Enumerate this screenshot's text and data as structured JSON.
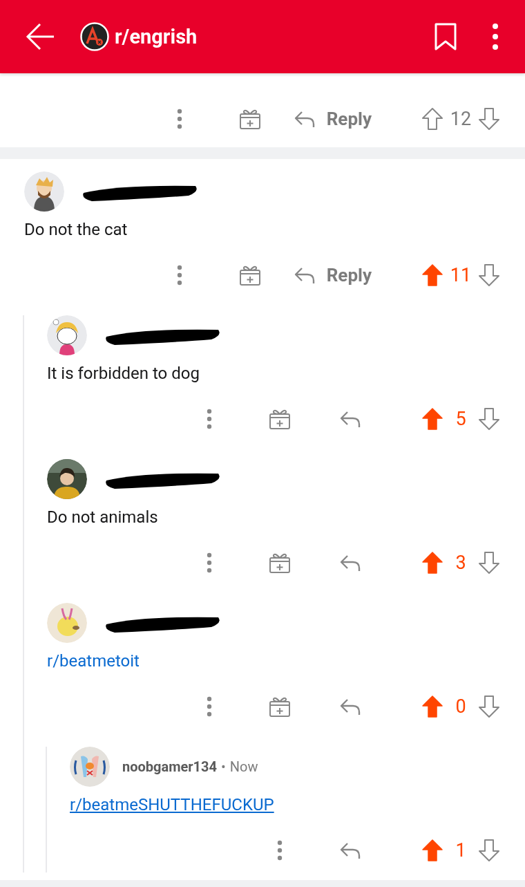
{
  "header": {
    "title": "r/engrish"
  },
  "partial_comment": {
    "actions": {
      "gift": true,
      "reply_label": "Reply",
      "upvoted": false,
      "score": "12"
    }
  },
  "comments": [
    {
      "redacted": true,
      "body": {
        "kind": "text",
        "text": "Do not the cat"
      },
      "actions": {
        "gift": true,
        "reply_label": "Reply",
        "upvoted": true,
        "score": "11"
      },
      "children": [
        {
          "redacted": true,
          "body": {
            "kind": "text",
            "text": "It is forbidden to dog"
          },
          "actions": {
            "gift": true,
            "upvoted": true,
            "score": "5"
          }
        },
        {
          "redacted": true,
          "body": {
            "kind": "text",
            "text": "Do not animals"
          },
          "actions": {
            "gift": true,
            "upvoted": true,
            "score": "3"
          }
        },
        {
          "redacted": true,
          "body": {
            "kind": "link",
            "text": "r/beatmetoit",
            "underlined": false
          },
          "actions": {
            "gift": true,
            "upvoted": true,
            "score": "0"
          },
          "children": [
            {
              "redacted": false,
              "author": "noobgamer134",
              "separator": "•",
              "time": "Now",
              "body": {
                "kind": "link",
                "text": "r/beatmeSHUTTHEFUCKUP",
                "underlined": true
              },
              "actions": {
                "gift": false,
                "upvoted": true,
                "score": "1"
              }
            }
          ]
        }
      ]
    }
  ]
}
